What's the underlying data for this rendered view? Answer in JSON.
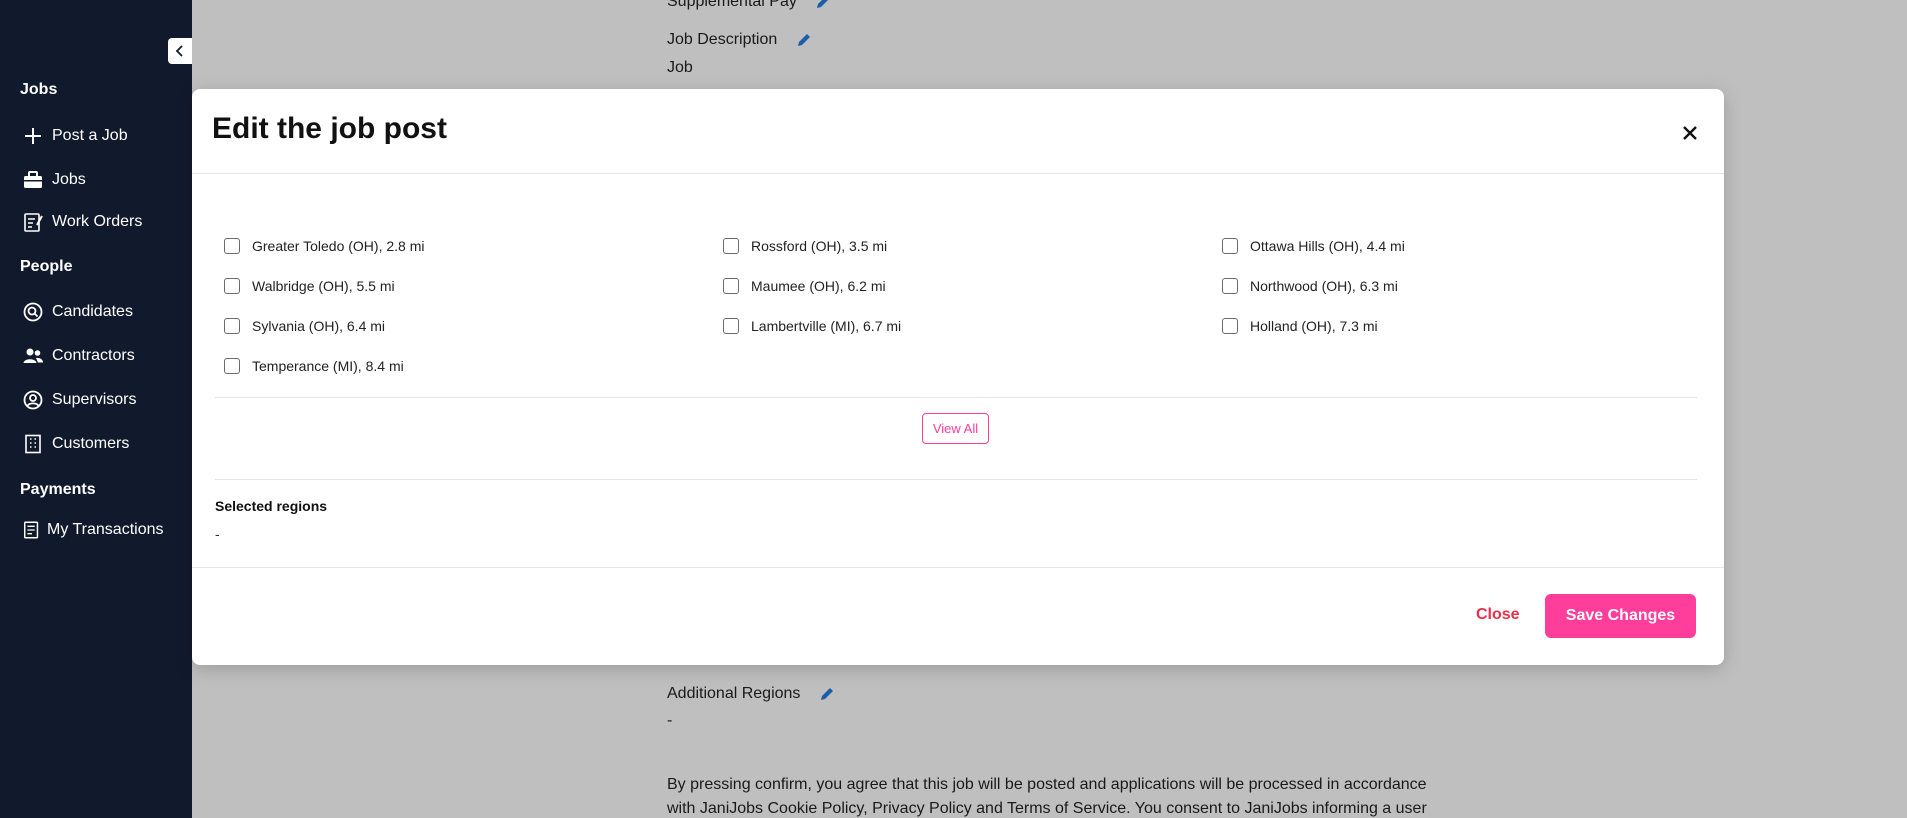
{
  "sidebar": {
    "sections": [
      {
        "label": "Jobs"
      },
      {
        "label": "People"
      },
      {
        "label": "Payments"
      }
    ],
    "items": [
      {
        "label": "Post a Job",
        "icon": "plus-icon"
      },
      {
        "label": "Jobs",
        "icon": "briefcase-icon"
      },
      {
        "label": "Work Orders",
        "icon": "work-order-icon"
      },
      {
        "label": "Candidates",
        "icon": "search-person-icon"
      },
      {
        "label": "Contractors",
        "icon": "people-icon"
      },
      {
        "label": "Supervisors",
        "icon": "user-circle-icon"
      },
      {
        "label": "Customers",
        "icon": "building-icon"
      },
      {
        "label": "My Transactions",
        "icon": "receipt-icon"
      }
    ]
  },
  "background": {
    "supplemental_pay": "Supplemental Pay",
    "job_description_label": "Job Description",
    "job_description_value": "Job",
    "additional_regions_label": "Additional Regions",
    "additional_regions_value": "-",
    "consent_line1": "By pressing confirm, you agree that this job will be posted and applications will be processed in accordance",
    "consent_line2": "with JaniJobs Cookie Policy, Privacy Policy and Terms of Service. You consent to JaniJobs informing a user"
  },
  "modal": {
    "title": "Edit the job post",
    "regions": [
      {
        "label": "Greater Toledo (OH), 2.8 mi",
        "checked": false
      },
      {
        "label": "Rossford (OH), 3.5 mi",
        "checked": false
      },
      {
        "label": "Ottawa Hills (OH), 4.4 mi",
        "checked": false
      },
      {
        "label": "Walbridge (OH), 5.5 mi",
        "checked": false
      },
      {
        "label": "Maumee (OH), 6.2 mi",
        "checked": false
      },
      {
        "label": "Northwood (OH), 6.3 mi",
        "checked": false
      },
      {
        "label": "Sylvania (OH), 6.4 mi",
        "checked": false
      },
      {
        "label": "Lambertville (MI), 6.7 mi",
        "checked": false
      },
      {
        "label": "Holland (OH), 7.3 mi",
        "checked": false
      },
      {
        "label": "Temperance (MI), 8.4 mi",
        "checked": false
      }
    ],
    "view_all_label": "View All",
    "selected_regions_label": "Selected regions",
    "selected_regions_value": "-",
    "close_label": "Close",
    "save_label": "Save Changes"
  },
  "colors": {
    "sidebar_bg": "#111a2c",
    "accent_pink": "#ff3d9a",
    "close_red": "#e8304a",
    "pencil_blue": "#1a5fa8"
  }
}
